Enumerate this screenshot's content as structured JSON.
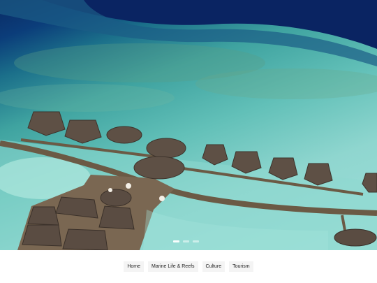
{
  "hero": {
    "image": "overwater-villas-aerial",
    "slides": 3,
    "active_slide": 1
  },
  "nav": {
    "items": [
      {
        "label": "Home"
      },
      {
        "label": "Marine Life & Reefs"
      },
      {
        "label": "Culture"
      },
      {
        "label": "Tourism"
      }
    ]
  }
}
